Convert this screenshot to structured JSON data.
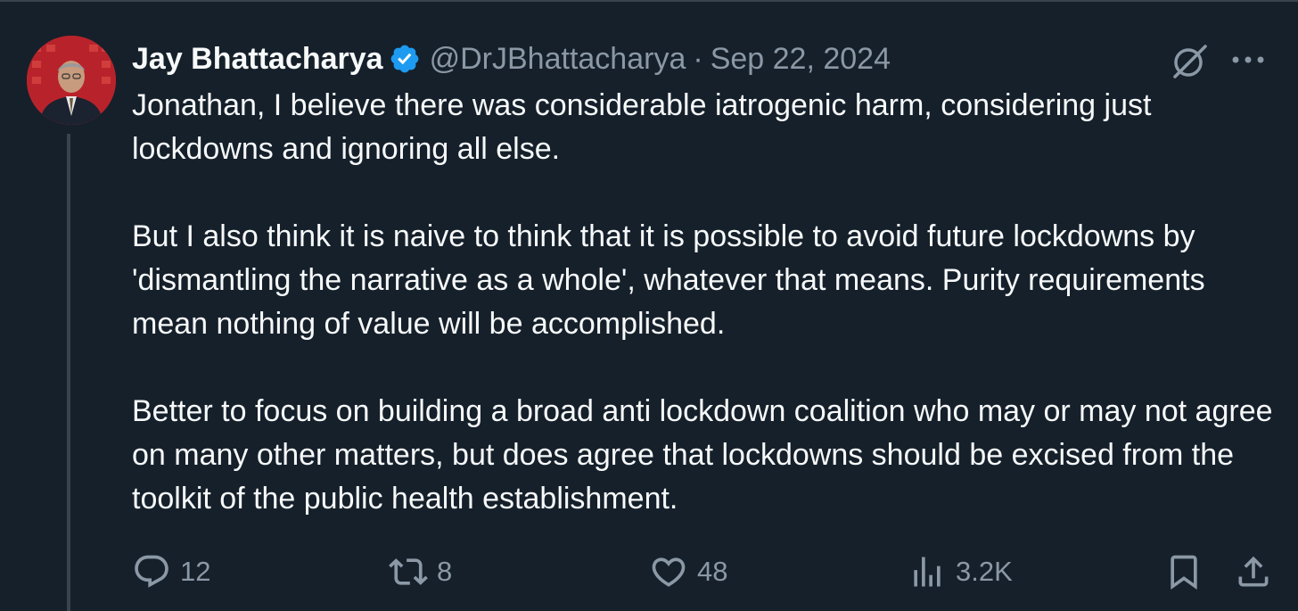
{
  "author": {
    "name": "Jay Bhattacharya",
    "handle": "@DrJBhattacharya",
    "separator": "·",
    "date": "Sep 22, 2024",
    "verified": true,
    "avatar_bg_color": "#c0272d"
  },
  "tweet": {
    "paragraphs": [
      "Jonathan, I believe there was considerable iatrogenic harm, considering just lockdowns and ignoring all else.",
      "But I also think it is naive to think that it is possible to avoid future lockdowns by 'dismantling the narrative as a whole', whatever that means. Purity requirements mean nothing of value will be accomplished.",
      "Better to focus on building a broad anti lockdown coalition who may or may not agree on many other matters, but does agree that lockdowns should be excised from the toolkit of the public health establishment."
    ]
  },
  "actions": {
    "replies": "12",
    "retweets": "8",
    "likes": "48",
    "views": "3.2K",
    "icons": [
      "reply-icon",
      "retweet-icon",
      "like-icon",
      "views-icon",
      "bookmark-icon",
      "share-icon"
    ]
  },
  "colors": {
    "background": "#15202b",
    "text": "#f7f9f9",
    "muted": "#8b98a5",
    "verified": "#1d9bf0",
    "thread_line": "#38444d"
  }
}
